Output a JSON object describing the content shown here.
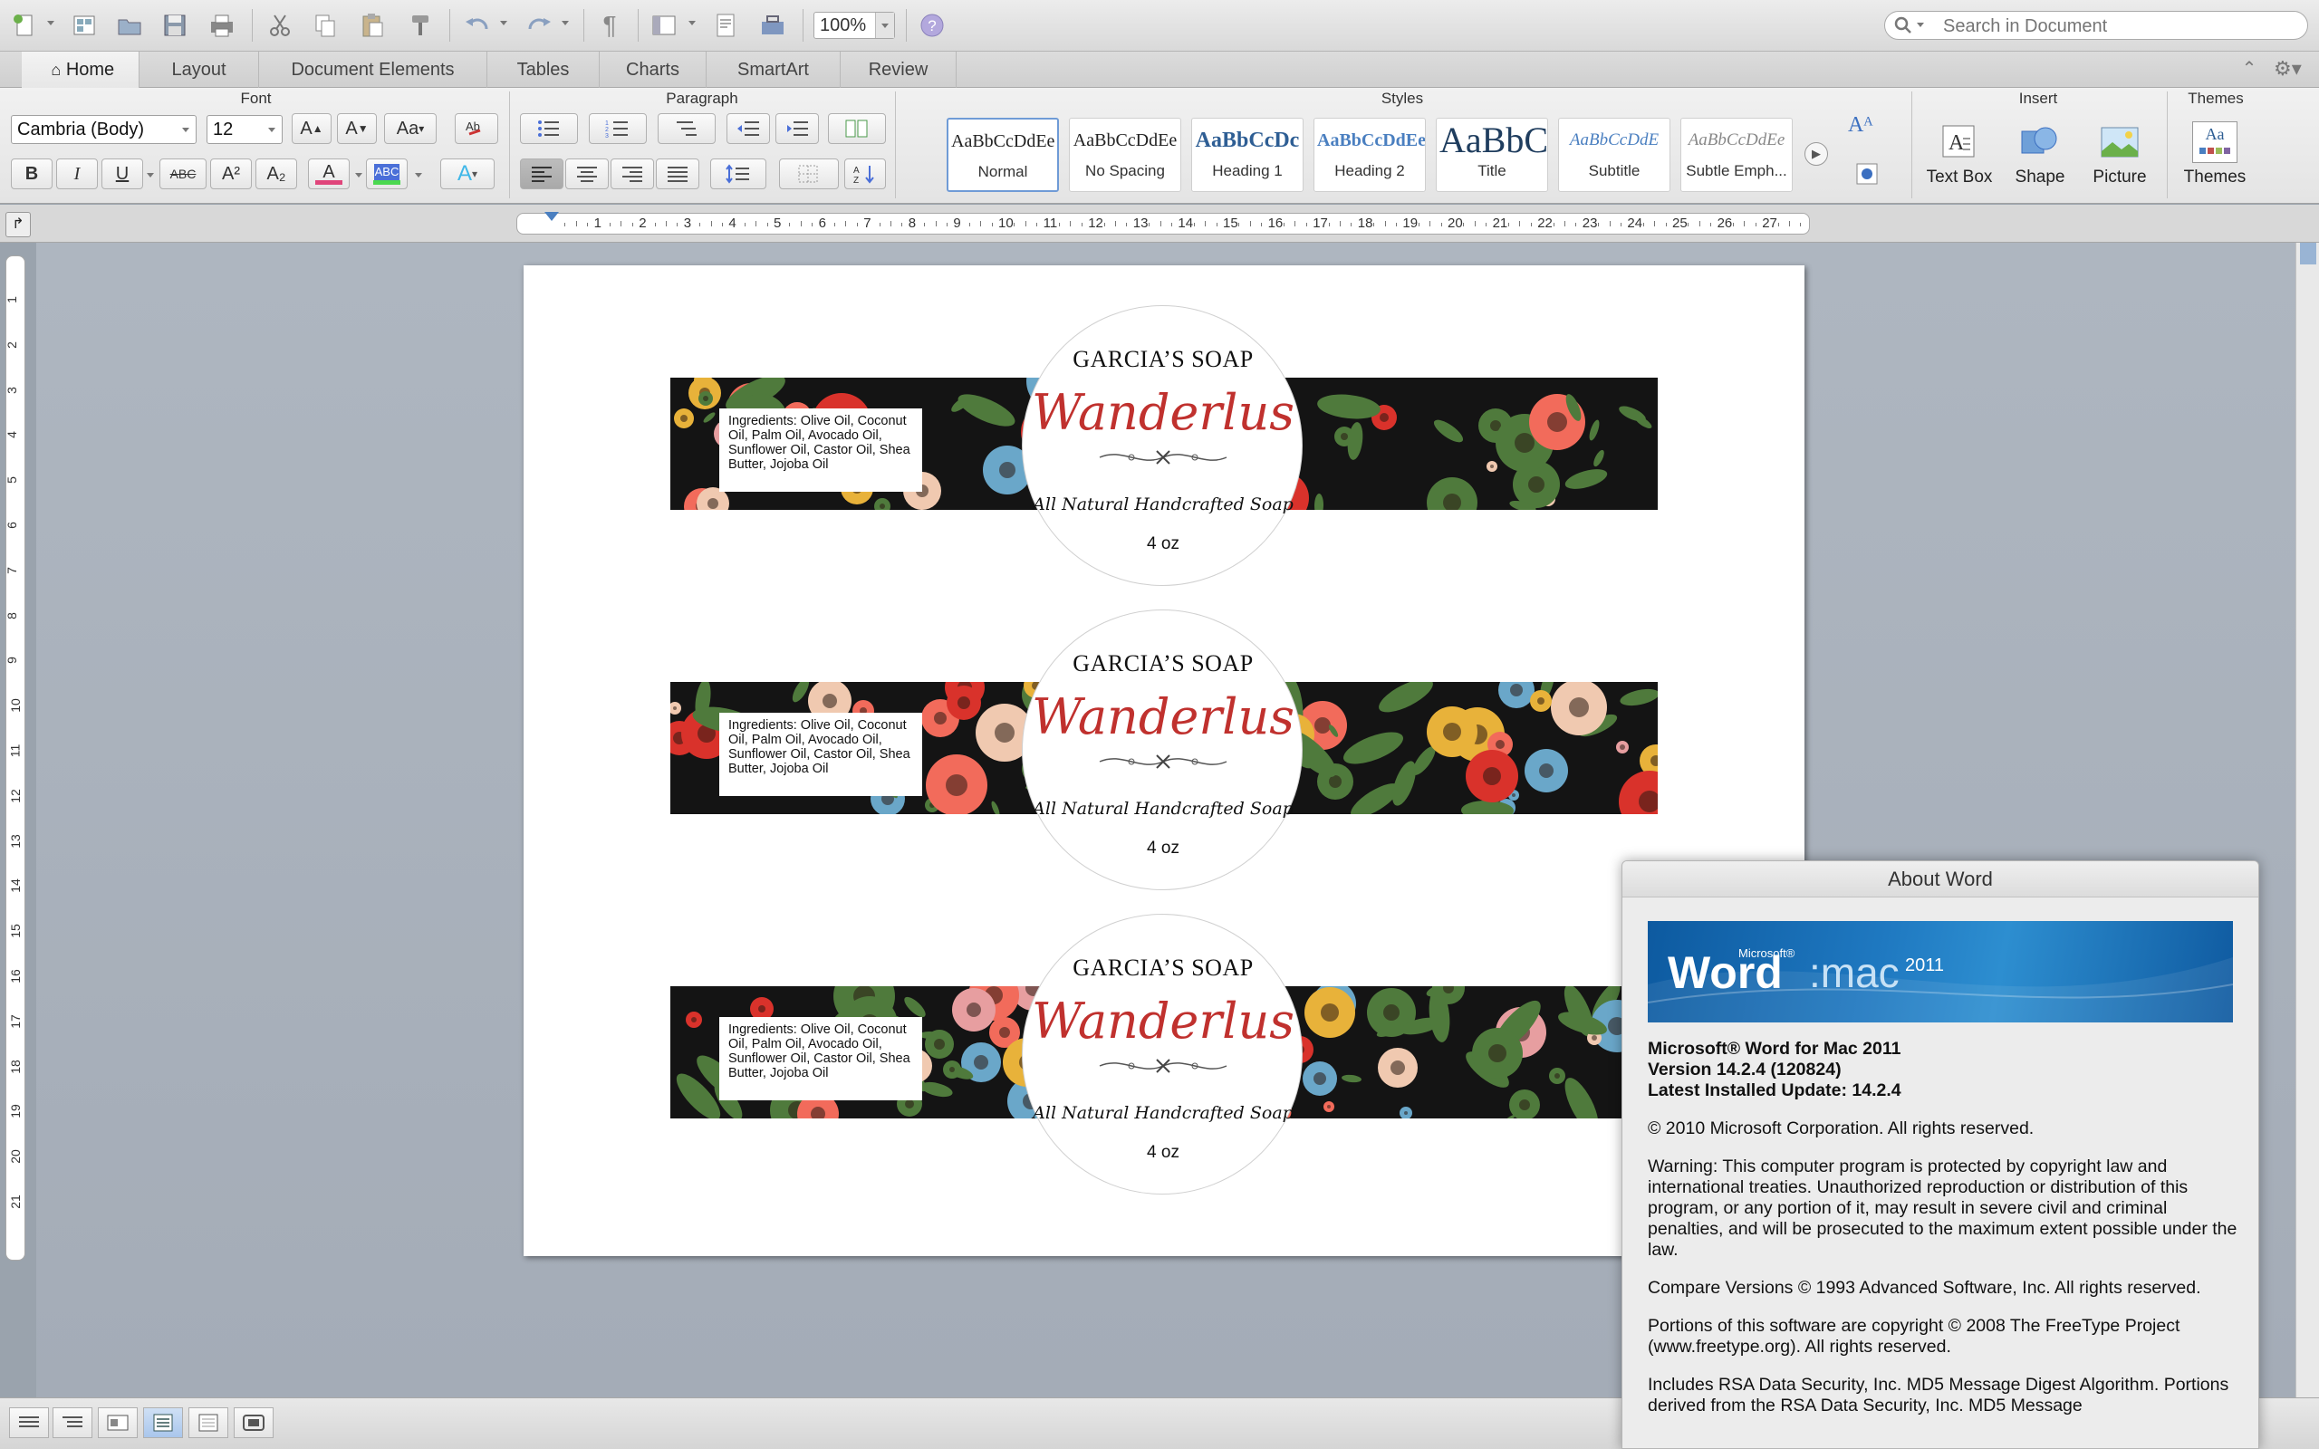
{
  "toolbar": {
    "zoom_value": "100%",
    "search_placeholder": "Search in Document",
    "icons": [
      "new-icon",
      "templates-icon",
      "open-icon",
      "save-icon",
      "print-icon",
      "cut-icon",
      "copy-icon",
      "paste-icon",
      "format-painter-icon",
      "undo-icon",
      "redo-icon",
      "pilcrow-icon",
      "sidebar-icon",
      "media-browser-icon",
      "toolbox-icon",
      "help-icon"
    ]
  },
  "tabs": [
    "Home",
    "Layout",
    "Document Elements",
    "Tables",
    "Charts",
    "SmartArt",
    "Review"
  ],
  "ribbon": {
    "font": {
      "title": "Font",
      "name": "Cambria (Body)",
      "size": "12",
      "bold": "B",
      "italic": "I",
      "underline": "U",
      "strike": "ABC",
      "sup": "A²",
      "sub": "A₂",
      "grow": "A",
      "shrink": "A",
      "case": "Aa",
      "color_letter": "A",
      "highlight": "ABC",
      "effects": "A"
    },
    "paragraph": {
      "title": "Paragraph"
    },
    "styles": {
      "title": "Styles",
      "items": [
        {
          "preview": "AaBbCcDdEe",
          "name": "Normal"
        },
        {
          "preview": "AaBbCcDdEe",
          "name": "No Spacing"
        },
        {
          "preview": "AaBbCcDc",
          "name": "Heading 1"
        },
        {
          "preview": "AaBbCcDdEe",
          "name": "Heading 2"
        },
        {
          "preview": "AaBbC",
          "name": "Title"
        },
        {
          "preview": "AaBbCcDdE",
          "name": "Subtitle"
        },
        {
          "preview": "AaBbCcDdEe",
          "name": "Subtle Emph..."
        }
      ]
    },
    "insert": {
      "title": "Insert",
      "items": [
        "Text Box",
        "Shape",
        "Picture"
      ]
    },
    "themes": {
      "title": "Themes",
      "label": "Themes",
      "preview": "Aa"
    }
  },
  "ruler": {
    "h_labels": [
      "1",
      "2",
      "3",
      "4",
      "5",
      "6",
      "7",
      "8",
      "9",
      "10",
      "11",
      "12",
      "13",
      "14",
      "15",
      "16",
      "17",
      "18",
      "19",
      "20",
      "21",
      "22",
      "23",
      "24",
      "25",
      "26",
      "27"
    ],
    "v_labels": [
      "1",
      "2",
      "3",
      "4",
      "5",
      "6",
      "7",
      "8",
      "9",
      "10",
      "11",
      "12",
      "13",
      "14",
      "15",
      "16",
      "17",
      "18",
      "19",
      "20",
      "21"
    ]
  },
  "labels": [
    {
      "ingredients": "Ingredients: Olive Oil, Coconut Oil, Palm Oil, Avocado Oil, Sunflower Oil, Castor Oil, Shea Butter, Jojoba Oil",
      "brand": "GARCIA’S SOAP",
      "name": "Wanderlus",
      "tagline": "All Natural Handcrafted Soap",
      "weight": "4 oz"
    },
    {
      "ingredients": "Ingredients: Olive Oil, Coconut Oil, Palm Oil, Avocado Oil, Sunflower Oil, Castor Oil, Shea Butter, Jojoba Oil",
      "brand": "GARCIA’S SOAP",
      "name": "Wanderlus",
      "tagline": "All Natural Handcrafted Soap",
      "weight": "4 oz"
    },
    {
      "ingredients": "Ingredients: Olive Oil, Coconut Oil, Palm Oil, Avocado Oil, Sunflower Oil, Castor Oil, Shea Butter, Jojoba Oil",
      "brand": "GARCIA’S SOAP",
      "name": "Wanderlus",
      "tagline": "All Natural Handcrafted Soap",
      "weight": "4 oz"
    }
  ],
  "about": {
    "title": "About Word",
    "banner_brand": "Word",
    "banner_ms": "Microsoft®",
    "banner_mac": ":mac",
    "banner_year": "2011",
    "product": "Microsoft® Word for Mac 2011",
    "version": "Version 14.2.4 (120824)",
    "update": "Latest Installed Update: 14.2.4",
    "copyright": "© 2010 Microsoft Corporation. All rights reserved.",
    "warning": "Warning: This computer program is protected by copyright law and international treaties.  Unauthorized reproduction or distribution of this program, or any portion of it, may result in severe civil and criminal penalties, and will be prosecuted to the maximum extent possible under the law.",
    "compare": "Compare Versions © 1993 Advanced Software, Inc.  All rights reserved.",
    "freetype": "Portions of this software are copyright © 2008 The FreeType Project (www.freetype.org).  All rights reserved.",
    "rsa": "Includes RSA Data Security, Inc. MD5 Message Digest Algorithm.  Portions derived from the RSA Data Security, Inc. MD5 Message"
  },
  "colors": {
    "accent": "#c0312e",
    "selection": "#6f9bd6",
    "banner": "#1f79c1"
  }
}
